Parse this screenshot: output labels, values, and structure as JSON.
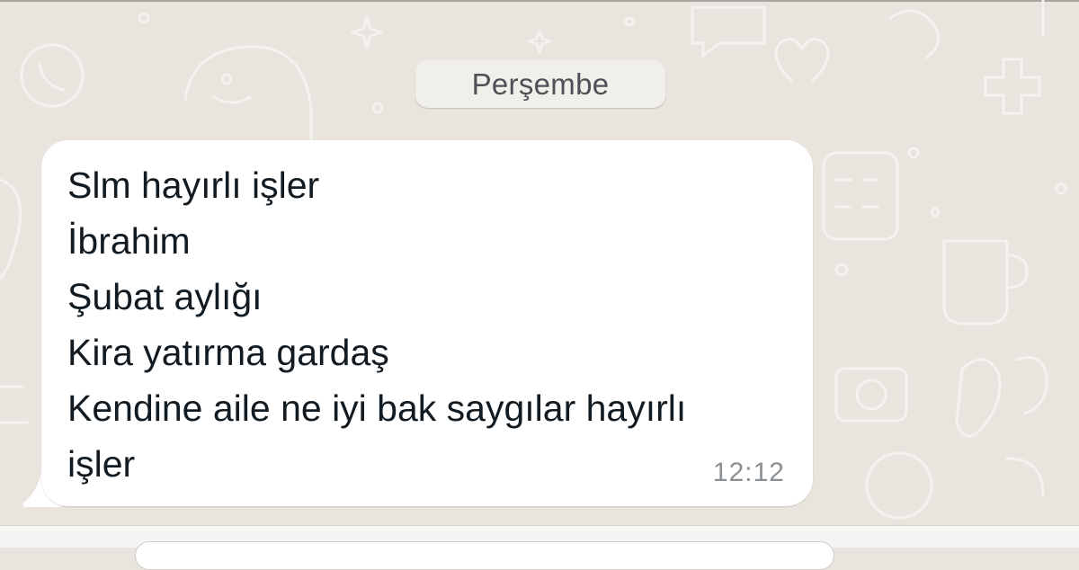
{
  "chat": {
    "date_separator": "Perşembe",
    "message": {
      "lines": [
        "Slm hayırlı işler",
        "İbrahim",
        "Şubat aylığı",
        "Kira yatırma gardaş",
        "Kendine aile ne iyi bak saygılar hayırlı",
        "işler"
      ],
      "time": "12:12"
    }
  },
  "colors": {
    "wallpaper": "#e9e5de",
    "bubble": "#ffffff",
    "text": "#111b21",
    "timestamp": "#8a8f93"
  },
  "icons": [
    "whatsapp-doodle-wallpaper"
  ]
}
